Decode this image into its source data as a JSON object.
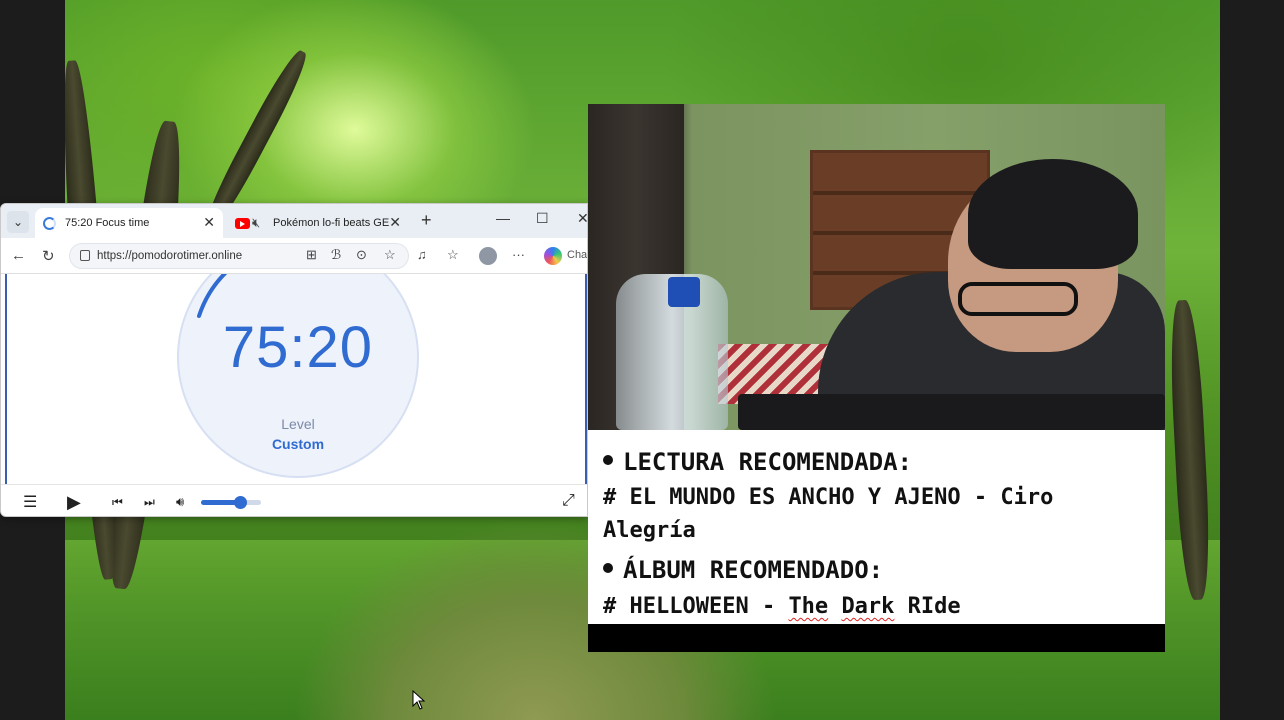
{
  "browser": {
    "tabs": [
      {
        "title": "75:20 Focus time",
        "icon": "loading-spinner-icon",
        "active": true
      },
      {
        "title": "Pokémon lo-fi beats GEN",
        "icon": "youtube-icon",
        "muted_icon": "speaker-muted-icon",
        "active": false
      }
    ],
    "new_tab_label": "+",
    "address": {
      "url": "https://pomodorotimer.online"
    },
    "chat_label": "Chat"
  },
  "timer": {
    "time": "75:20",
    "level_label": "Level",
    "level_value": "Custom",
    "accent_color": "#2f6bd0"
  },
  "player": {
    "volume_level": 0.65
  },
  "notes": {
    "reading_heading": "LECTURA RECOMENDADA:",
    "reading_line1": "# EL MUNDO ES ANCHO Y AJENO - Ciro",
    "reading_line2": "Alegría",
    "album_heading": "ÁLBUM RECOMENDADO:",
    "album_prefix": "# HELLOWEEN - ",
    "album_word1": "The",
    "album_word2": "Dark",
    "album_word3": "RIde"
  }
}
